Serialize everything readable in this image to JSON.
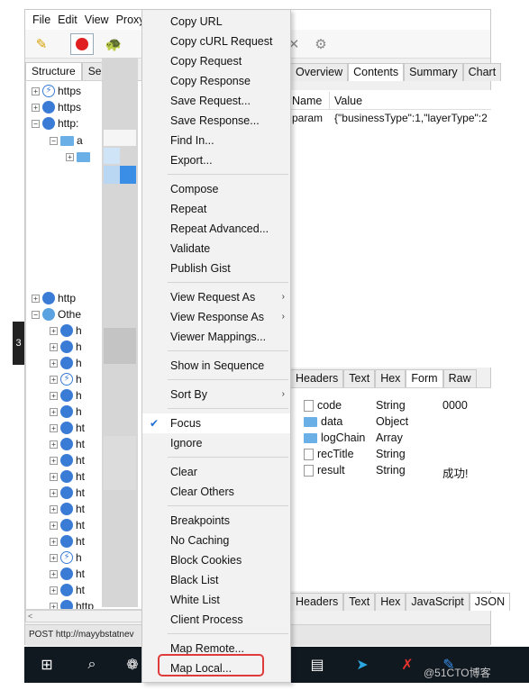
{
  "window": {
    "menubar": [
      "File",
      "Edit",
      "View",
      "Proxy"
    ],
    "left_tabs": [
      "Structure",
      "Se"
    ]
  },
  "tree": {
    "rows": [
      {
        "label": "https",
        "kind": "bolt"
      },
      {
        "label": "https",
        "kind": "globe"
      },
      {
        "label": "http:",
        "kind": "globe"
      },
      {
        "label": "a",
        "kind": "folder"
      },
      {
        "label": "",
        "kind": "folder"
      },
      {
        "label": "http",
        "kind": "globe"
      },
      {
        "label": "Othe",
        "kind": "flower"
      },
      {
        "label": "h",
        "kind": "globe"
      },
      {
        "label": "h",
        "kind": "globe"
      },
      {
        "label": "h",
        "kind": "globe"
      },
      {
        "label": "h",
        "kind": "bolt"
      },
      {
        "label": "h",
        "kind": "globe"
      },
      {
        "label": "h",
        "kind": "globe"
      },
      {
        "label": "ht",
        "kind": "globe"
      },
      {
        "label": "ht",
        "kind": "globe"
      },
      {
        "label": "ht",
        "kind": "globe"
      },
      {
        "label": "ht",
        "kind": "globe"
      },
      {
        "label": "ht",
        "kind": "globe"
      },
      {
        "label": "ht",
        "kind": "globe"
      },
      {
        "label": "ht",
        "kind": "globe"
      },
      {
        "label": "ht",
        "kind": "globe"
      },
      {
        "label": "h",
        "kind": "bolt"
      },
      {
        "label": "ht",
        "kind": "globe"
      },
      {
        "label": "ht",
        "kind": "globe"
      },
      {
        "label": "http",
        "kind": "globe"
      }
    ],
    "scroll_left": "<"
  },
  "status_bar": "POST http://mayybstatnev",
  "right": {
    "top_tabs": [
      "Overview",
      "Contents",
      "Summary",
      "Chart"
    ],
    "grid_headers": [
      "Name",
      "Value"
    ],
    "grid_row": {
      "name": "param",
      "value": "{\"businessType\":1,\"layerType\":2"
    },
    "mid_tabs": [
      "Headers",
      "Text",
      "Hex",
      "Form",
      "Raw"
    ],
    "json_rows": [
      {
        "name": "code",
        "type": "String",
        "value": "0000",
        "icon": "doc"
      },
      {
        "name": "data",
        "type": "Object",
        "value": "",
        "icon": "folder"
      },
      {
        "name": "logChain",
        "type": "Array",
        "value": "",
        "icon": "folder"
      },
      {
        "name": "recTitle",
        "type": "String",
        "value": "",
        "icon": "doc"
      },
      {
        "name": "result",
        "type": "String",
        "value": "成功!",
        "icon": "doc"
      }
    ],
    "bottom_tabs": [
      "Headers",
      "Text",
      "Hex",
      "JavaScript",
      "JSON"
    ]
  },
  "context_menu": {
    "groups": [
      [
        "Copy URL",
        "Copy cURL Request",
        "Copy Request",
        "Copy Response",
        "Save Request...",
        "Save Response...",
        "Find In...",
        "Export..."
      ],
      [
        "Compose",
        "Repeat",
        "Repeat Advanced...",
        "Validate",
        "Publish Gist"
      ],
      [
        "View Request As",
        "View Response As",
        "Viewer Mappings..."
      ],
      [
        "Show in Sequence"
      ],
      [
        "Sort By"
      ],
      [
        "Focus",
        "Ignore"
      ],
      [
        "Clear",
        "Clear Others"
      ],
      [
        "Breakpoints",
        "No Caching",
        "Block Cookies",
        "Black List",
        "White List",
        "Client Process"
      ],
      [
        "Map Remote...",
        "Map Local..."
      ]
    ],
    "submenu_items": [
      "View Request As",
      "View Response As",
      "Sort By"
    ],
    "checked_item": "Focus",
    "highlighted_item": "Map Local..."
  },
  "watermark": "@51CTO博客",
  "edge_label": "3",
  "colors": {
    "accent": "#1e6fd6",
    "highlight_box": "#e03b3b",
    "taskbar": "#101820"
  }
}
